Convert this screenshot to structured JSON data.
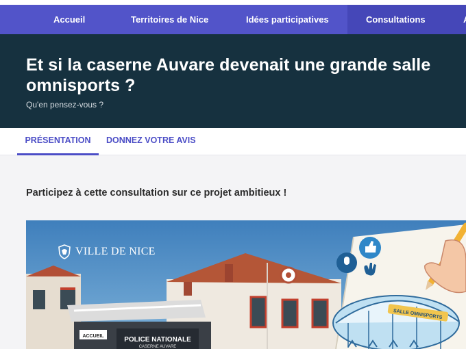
{
  "nav": {
    "items": [
      {
        "label": "Accueil"
      },
      {
        "label": "Territoires de Nice"
      },
      {
        "label": "Idées participatives"
      },
      {
        "label": "Consultations"
      },
      {
        "label": "A"
      }
    ]
  },
  "hero": {
    "title": "Et si la caserne Auvare devenait une grande salle omnisports ?",
    "subtitle": "Qu'en pensez-vous ?"
  },
  "tabs": [
    {
      "label": "PRÉSENTATION"
    },
    {
      "label": "DONNEZ VOTRE AVIS"
    }
  ],
  "intro": "Participez à cette consultation sur ce projet ambitieux !",
  "banner": {
    "brand": "VILLE DE NICE",
    "sign_accueil": "ACCUEIL",
    "sign_police": "POLICE NATIONALE",
    "sign_caserne": "CASERNE AUVARE",
    "sign_salle": "SALLE OMNISPORTS"
  },
  "colors": {
    "nav_bg": "#5254c9",
    "hero_bg": "#16313f",
    "accent": "#4b4dc6",
    "main_bg": "#f4f4f6"
  }
}
